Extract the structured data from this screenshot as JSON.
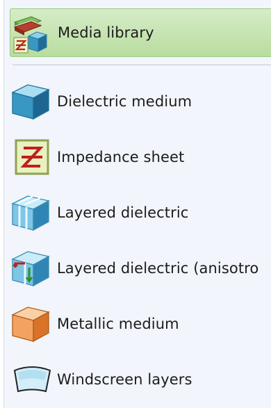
{
  "menu": {
    "header": {
      "label": "Media library",
      "icon": "media-library-icon"
    },
    "items": [
      {
        "label": "Dielectric medium",
        "icon": "dielectric-cube-icon"
      },
      {
        "label": "Impedance sheet",
        "icon": "impedance-sheet-icon"
      },
      {
        "label": "Layered dielectric",
        "icon": "layered-cube-icon"
      },
      {
        "label": "Layered dielectric (anisotro",
        "icon": "anisotropic-layered-cube-icon"
      },
      {
        "label": "Metallic medium",
        "icon": "metallic-cube-icon"
      },
      {
        "label": "Windscreen layers",
        "icon": "windscreen-icon"
      }
    ]
  },
  "colors": {
    "highlight": "#b8dd9f",
    "menu_background": "#f2f5fb",
    "dielectric_blue": "#2f8bb8",
    "metallic_orange": "#e98a3b",
    "impedance_red": "#c0201a"
  }
}
